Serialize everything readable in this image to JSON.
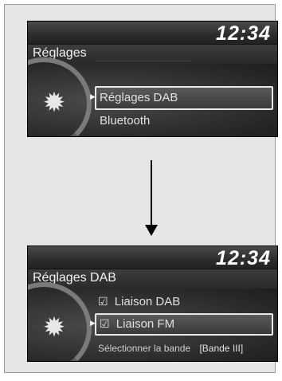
{
  "screens": [
    {
      "clock": "12:34",
      "title": "Réglages",
      "items": [
        {
          "label": "Réglages DAB",
          "selected": true
        },
        {
          "label": "Bluetooth",
          "selected": false
        }
      ]
    },
    {
      "clock": "12:34",
      "title": "Réglages DAB",
      "items": [
        {
          "label": "Liaison DAB",
          "checked": true,
          "selected": false
        },
        {
          "label": "Liaison FM",
          "checked": true,
          "selected": true
        },
        {
          "label": "Sélectionner la bande",
          "value": "Bande III",
          "selected": false
        }
      ]
    }
  ],
  "icons": {
    "settings": "gear-icon",
    "pointer": "triangle-pointer-icon",
    "check": "checkbox-checked-icon",
    "transition": "down-arrow-icon"
  }
}
